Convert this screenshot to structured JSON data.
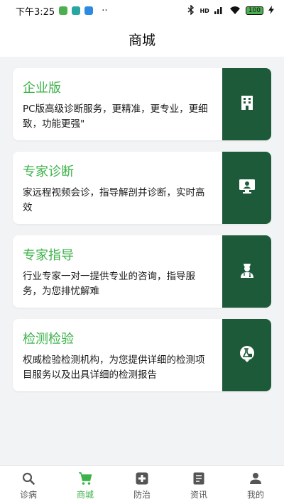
{
  "status_bar": {
    "time": "下午3:25",
    "dots": "··",
    "network": "HD",
    "battery": "100"
  },
  "header": {
    "title": "商城"
  },
  "cards": [
    {
      "title": "企业版",
      "description": "PC版高级诊断服务，更精准，更专业，更细致，功能更强\"",
      "icon": "building-icon"
    },
    {
      "title": "专家诊断",
      "description": "家远程视频会诊，指导解剖并诊断，实时高效",
      "icon": "video-consult-icon"
    },
    {
      "title": "专家指导",
      "description": "行业专家一对一提供专业的咨询，指导服务，为您排忧解难",
      "icon": "doctor-icon"
    },
    {
      "title": "检测检验",
      "description": "权威检验检测机构，为您提供详细的检测项目服务以及出具详细的检测报告",
      "icon": "lab-test-icon"
    }
  ],
  "tabs": [
    {
      "label": "诊病",
      "icon": "search-icon"
    },
    {
      "label": "商城",
      "icon": "cart-icon",
      "active": true
    },
    {
      "label": "防治",
      "icon": "medical-plus-icon"
    },
    {
      "label": "资讯",
      "icon": "news-icon"
    },
    {
      "label": "我的",
      "icon": "person-icon"
    }
  ],
  "colors": {
    "accent": "#3db24a",
    "card_side": "#1d5a3a",
    "background": "#f2f3f5"
  }
}
